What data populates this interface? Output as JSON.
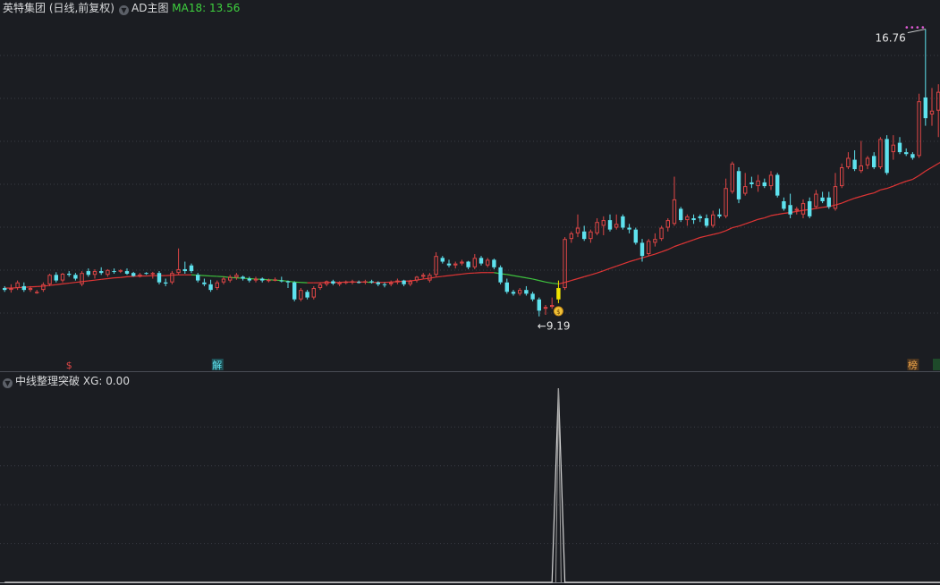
{
  "header": {
    "title": "英特集团 (日线,前复权)",
    "main_indicator": "AD主图",
    "ma_label": "MA18:",
    "ma_value": "13.56"
  },
  "lower_panel": {
    "title": "中线整理突破",
    "xg_label": "XG:",
    "xg_value": "0.00"
  },
  "colors": {
    "background": "#1b1d22",
    "up": "#e04646",
    "down": "#5ee2ee",
    "signal": "#f2e500",
    "ma_up": "#e03535",
    "ma_down": "#3ec23e",
    "grid": "#3a3d44",
    "indicator_line": "#d6d6d6"
  },
  "chart_data": [
    {
      "type": "candlestick",
      "title": "英特集团 (日线,前复权)",
      "ylim": [
        8.1,
        17.2
      ],
      "grid": true,
      "candles": [
        [
          9.9,
          9.95,
          9.8,
          9.85
        ],
        [
          9.85,
          10.0,
          9.78,
          9.9
        ],
        [
          9.9,
          10.1,
          9.85,
          10.05
        ],
        [
          9.95,
          10.05,
          9.8,
          9.85
        ],
        [
          9.85,
          9.95,
          9.8,
          9.9
        ],
        [
          9.8,
          9.85,
          9.75,
          9.8
        ],
        [
          9.85,
          10.05,
          9.8,
          10.0
        ],
        [
          10.0,
          10.28,
          9.95,
          10.25
        ],
        [
          10.25,
          10.32,
          10.05,
          10.1
        ],
        [
          10.1,
          10.3,
          10.05,
          10.28
        ],
        [
          10.28,
          10.35,
          10.2,
          10.25
        ],
        [
          10.25,
          10.3,
          10.1,
          10.15
        ],
        [
          10.0,
          10.35,
          9.95,
          10.3
        ],
        [
          10.35,
          10.42,
          10.2,
          10.25
        ],
        [
          10.25,
          10.4,
          10.15,
          10.35
        ],
        [
          10.35,
          10.45,
          10.25,
          10.3
        ],
        [
          10.25,
          10.4,
          10.2,
          10.38
        ],
        [
          10.35,
          10.42,
          10.28,
          10.33
        ],
        [
          10.35,
          10.4,
          10.3,
          10.37
        ],
        [
          10.35,
          10.42,
          10.25,
          10.28
        ],
        [
          10.3,
          10.33,
          10.2,
          10.22
        ],
        [
          10.2,
          10.3,
          10.18,
          10.26
        ],
        [
          10.3,
          10.32,
          10.25,
          10.28
        ],
        [
          10.28,
          10.33,
          10.15,
          10.3
        ],
        [
          10.3,
          10.35,
          10.0,
          10.05
        ],
        [
          10.05,
          10.15,
          9.95,
          10.02
        ],
        [
          10.05,
          10.35,
          10.0,
          10.3
        ],
        [
          10.3,
          10.95,
          10.25,
          10.4
        ],
        [
          10.4,
          10.6,
          10.28,
          10.35
        ],
        [
          10.5,
          10.55,
          10.3,
          10.35
        ],
        [
          10.25,
          10.3,
          10.05,
          10.1
        ],
        [
          10.05,
          10.15,
          9.95,
          10.0
        ],
        [
          10.0,
          10.12,
          9.8,
          9.85
        ],
        [
          9.9,
          10.1,
          9.85,
          10.05
        ],
        [
          10.05,
          10.2,
          10.0,
          10.15
        ],
        [
          10.1,
          10.25,
          10.05,
          10.2
        ],
        [
          10.18,
          10.3,
          10.12,
          10.25
        ],
        [
          10.2,
          10.23,
          10.1,
          10.15
        ],
        [
          10.15,
          10.2,
          10.05,
          10.1
        ],
        [
          10.1,
          10.2,
          10.05,
          10.15
        ],
        [
          10.15,
          10.18,
          10.05,
          10.1
        ],
        [
          10.1,
          10.15,
          10.05,
          10.12
        ],
        [
          10.12,
          10.18,
          10.08,
          10.13
        ],
        [
          10.1,
          10.2,
          10.05,
          10.08
        ],
        [
          10.08,
          10.1,
          9.9,
          10.05
        ],
        [
          10.05,
          10.08,
          9.55,
          9.6
        ],
        [
          9.6,
          9.9,
          9.55,
          9.85
        ],
        [
          9.8,
          9.85,
          9.6,
          9.65
        ],
        [
          9.65,
          9.95,
          9.6,
          9.9
        ],
        [
          9.9,
          10.05,
          9.85,
          10.0
        ],
        [
          10.0,
          10.1,
          9.95,
          10.08
        ],
        [
          10.08,
          10.12,
          9.98,
          10.02
        ],
        [
          10.0,
          10.08,
          9.95,
          10.05
        ],
        [
          10.05,
          10.1,
          10.0,
          10.07
        ],
        [
          10.05,
          10.12,
          10.0,
          10.08
        ],
        [
          10.06,
          10.1,
          10.02,
          10.05
        ],
        [
          10.05,
          10.12,
          10.0,
          10.08
        ],
        [
          10.08,
          10.12,
          10.02,
          10.05
        ],
        [
          10.05,
          10.08,
          9.95,
          10.0
        ],
        [
          10.0,
          10.05,
          9.92,
          9.98
        ],
        [
          10.0,
          10.1,
          9.95,
          10.05
        ],
        [
          10.05,
          10.15,
          10.0,
          10.1
        ],
        [
          10.1,
          10.12,
          9.95,
          10.0
        ],
        [
          10.0,
          10.12,
          9.95,
          10.08
        ],
        [
          10.1,
          10.22,
          10.05,
          10.2
        ],
        [
          10.2,
          10.3,
          10.15,
          10.25
        ],
        [
          10.1,
          10.3,
          10.05,
          10.25
        ],
        [
          10.25,
          10.85,
          10.2,
          10.75
        ],
        [
          10.7,
          10.75,
          10.55,
          10.6
        ],
        [
          10.55,
          10.65,
          10.45,
          10.5
        ],
        [
          10.5,
          10.6,
          10.42,
          10.55
        ],
        [
          10.55,
          10.65,
          10.5,
          10.6
        ],
        [
          10.6,
          10.62,
          10.4,
          10.45
        ],
        [
          10.45,
          10.8,
          10.4,
          10.7
        ],
        [
          10.7,
          10.75,
          10.5,
          10.55
        ],
        [
          10.5,
          10.7,
          10.45,
          10.65
        ],
        [
          10.65,
          10.68,
          10.4,
          10.45
        ],
        [
          10.45,
          10.5,
          10.0,
          10.05
        ],
        [
          10.05,
          10.15,
          9.75,
          9.8
        ],
        [
          9.8,
          9.85,
          9.7,
          9.75
        ],
        [
          9.75,
          9.9,
          9.7,
          9.85
        ],
        [
          9.85,
          9.95,
          9.7,
          9.75
        ],
        [
          9.75,
          9.8,
          9.55,
          9.6
        ],
        [
          9.6,
          9.65,
          9.15,
          9.3
        ],
        [
          9.35,
          9.45,
          9.19,
          9.4
        ],
        [
          9.4,
          9.65,
          9.35,
          9.45
        ],
        [
          9.6,
          10.1,
          9.5,
          9.9
        ],
        [
          9.9,
          11.25,
          9.85,
          11.2
        ],
        [
          11.2,
          11.4,
          11.1,
          11.35
        ],
        [
          11.35,
          11.85,
          11.25,
          11.5
        ],
        [
          11.4,
          11.55,
          11.15,
          11.2
        ],
        [
          11.2,
          11.45,
          11.1,
          11.4
        ],
        [
          11.35,
          11.75,
          11.3,
          11.65
        ],
        [
          11.55,
          11.8,
          11.3,
          11.7
        ],
        [
          11.7,
          11.85,
          11.4,
          11.45
        ],
        [
          11.5,
          11.85,
          11.45,
          11.6
        ],
        [
          11.8,
          11.85,
          11.45,
          11.5
        ],
        [
          11.5,
          11.6,
          11.35,
          11.45
        ],
        [
          11.45,
          11.5,
          11.05,
          11.1
        ],
        [
          11.1,
          11.2,
          10.6,
          10.75
        ],
        [
          10.8,
          11.2,
          10.75,
          11.15
        ],
        [
          11.1,
          11.35,
          11.0,
          11.2
        ],
        [
          11.2,
          11.55,
          11.15,
          11.5
        ],
        [
          11.5,
          11.75,
          11.4,
          11.7
        ],
        [
          11.6,
          12.85,
          11.55,
          12.25
        ],
        [
          12.0,
          12.05,
          11.65,
          11.7
        ],
        [
          11.7,
          11.85,
          11.55,
          11.8
        ],
        [
          11.75,
          11.85,
          11.6,
          11.7
        ],
        [
          11.8,
          11.85,
          11.65,
          11.75
        ],
        [
          11.75,
          11.85,
          11.5,
          11.55
        ],
        [
          11.55,
          11.95,
          11.5,
          11.85
        ],
        [
          11.85,
          12.0,
          11.75,
          11.8
        ],
        [
          11.8,
          12.8,
          11.75,
          12.55
        ],
        [
          12.45,
          13.25,
          12.4,
          13.2
        ],
        [
          13.0,
          13.1,
          12.15,
          12.25
        ],
        [
          12.4,
          12.95,
          12.35,
          12.6
        ],
        [
          12.7,
          12.85,
          12.55,
          12.65
        ],
        [
          12.6,
          12.9,
          12.45,
          12.75
        ],
        [
          12.7,
          12.8,
          12.55,
          12.6
        ],
        [
          12.6,
          13.0,
          12.5,
          12.9
        ],
        [
          12.9,
          12.95,
          12.3,
          12.35
        ],
        [
          12.2,
          12.3,
          11.95,
          12.0
        ],
        [
          12.1,
          12.4,
          11.75,
          11.85
        ],
        [
          11.95,
          12.05,
          11.85,
          12.0
        ],
        [
          11.85,
          12.25,
          11.75,
          12.15
        ],
        [
          12.2,
          12.3,
          11.75,
          11.8
        ],
        [
          12.05,
          12.5,
          12.0,
          12.4
        ],
        [
          12.3,
          12.45,
          12.15,
          12.2
        ],
        [
          12.3,
          12.45,
          12.0,
          12.05
        ],
        [
          12.0,
          12.95,
          11.95,
          12.6
        ],
        [
          12.6,
          13.2,
          12.55,
          13.1
        ],
        [
          13.1,
          13.5,
          13.05,
          13.35
        ],
        [
          13.3,
          13.55,
          13.0,
          13.05
        ],
        [
          13.0,
          13.8,
          12.95,
          13.15
        ],
        [
          13.15,
          13.4,
          13.05,
          13.35
        ],
        [
          13.4,
          13.5,
          13.05,
          13.1
        ],
        [
          13.1,
          13.9,
          13.05,
          13.85
        ],
        [
          13.85,
          13.95,
          12.9,
          12.95
        ],
        [
          13.5,
          13.95,
          13.3,
          13.7
        ],
        [
          13.75,
          13.9,
          13.45,
          13.5
        ],
        [
          13.5,
          13.6,
          13.4,
          13.45
        ],
        [
          13.45,
          13.5,
          13.3,
          13.35
        ],
        [
          13.4,
          15.05,
          13.35,
          14.85
        ],
        [
          14.95,
          16.76,
          14.2,
          14.4
        ],
        [
          14.5,
          15.2,
          14.2,
          14.6
        ],
        [
          14.6,
          15.3,
          13.9,
          15.1
        ],
        [
          15.1,
          15.3,
          13.9,
          14.1
        ]
      ],
      "ma18": [
        9.9,
        9.9,
        9.91,
        9.92,
        9.93,
        9.94,
        9.95,
        9.97,
        9.99,
        10.01,
        10.03,
        10.05,
        10.07,
        10.09,
        10.11,
        10.13,
        10.15,
        10.17,
        10.18,
        10.2,
        10.21,
        10.22,
        10.22,
        10.23,
        10.23,
        10.23,
        10.24,
        10.25,
        10.25,
        10.25,
        10.24,
        10.23,
        10.22,
        10.21,
        10.2,
        10.18,
        10.17,
        10.16,
        10.15,
        10.14,
        10.13,
        10.12,
        10.11,
        10.1,
        10.08,
        10.06,
        10.05,
        10.04,
        10.04,
        10.04,
        10.05,
        10.05,
        10.05,
        10.06,
        10.06,
        10.06,
        10.06,
        10.05,
        10.05,
        10.05,
        10.06,
        10.07,
        10.08,
        10.09,
        10.11,
        10.14,
        10.16,
        10.19,
        10.21,
        10.23,
        10.25,
        10.27,
        10.29,
        10.3,
        10.31,
        10.31,
        10.31,
        10.28,
        10.26,
        10.23,
        10.2,
        10.17,
        10.14,
        10.1,
        10.06,
        10.03,
        10.01,
        10.05,
        10.1,
        10.15,
        10.2,
        10.25,
        10.3,
        10.36,
        10.42,
        10.48,
        10.54,
        10.6,
        10.65,
        10.7,
        10.75,
        10.8,
        10.86,
        10.92,
        11.0,
        11.06,
        11.12,
        11.18,
        11.24,
        11.28,
        11.32,
        11.36,
        11.42,
        11.5,
        11.54,
        11.6,
        11.66,
        11.72,
        11.76,
        11.82,
        11.85,
        11.88,
        11.9,
        11.93,
        11.96,
        11.98,
        12.01,
        12.04,
        12.06,
        12.1,
        12.15,
        12.22,
        12.28,
        12.33,
        12.38,
        12.42,
        12.5,
        12.54,
        12.6,
        12.67,
        12.73,
        12.78,
        12.88,
        13.0,
        13.1,
        13.2,
        13.3
      ],
      "annotations": [
        {
          "text": "16.76",
          "kind": "high"
        },
        {
          "text": "←9.19",
          "kind": "low"
        },
        {
          "text": "$",
          "kind": "marker"
        },
        {
          "text": "解",
          "kind": "marker"
        },
        {
          "text": "榜",
          "kind": "marker"
        }
      ]
    },
    {
      "type": "line",
      "title": "中线整理突破",
      "ylim": [
        0,
        1
      ],
      "signal_index": 86,
      "signal_value": 1
    }
  ]
}
